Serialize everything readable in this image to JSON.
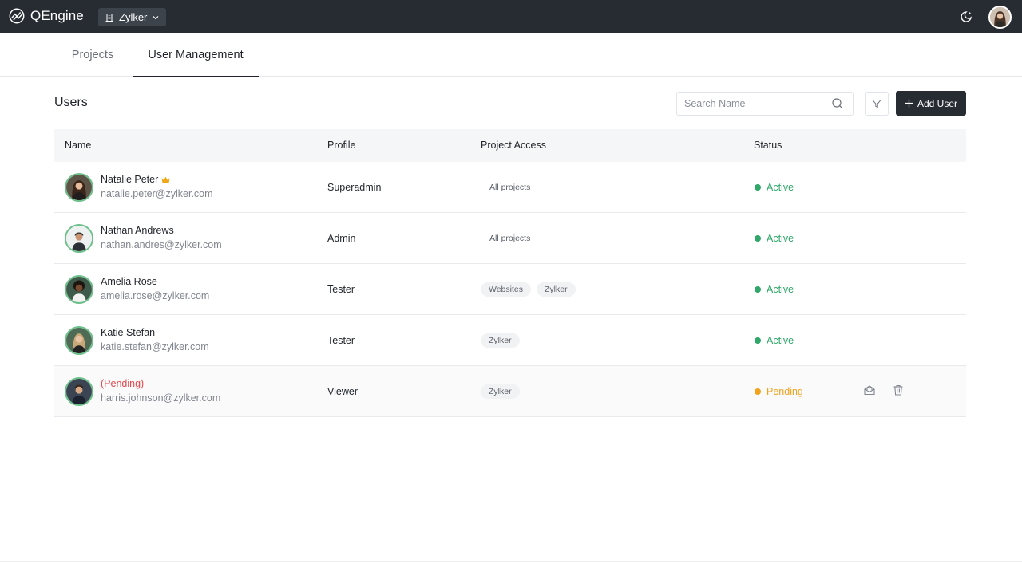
{
  "app": {
    "name": "QEngine",
    "org": "Zylker"
  },
  "tabs": [
    {
      "label": "Projects"
    },
    {
      "label": "User Management"
    }
  ],
  "section": {
    "title": "Users"
  },
  "search": {
    "placeholder": "Search Name",
    "value": ""
  },
  "toolbar": {
    "add_user_label": "Add User"
  },
  "table": {
    "headers": {
      "name": "Name",
      "profile": "Profile",
      "access": "Project Access",
      "status": "Status"
    },
    "rows": [
      {
        "name": "Natalie Peter",
        "email": "natalie.peter@zylker.com",
        "profile": "Superadmin",
        "access": [
          "All projects"
        ],
        "status": "Active"
      },
      {
        "name": "Nathan Andrews",
        "email": "nathan.andres@zylker.com",
        "profile": "Admin",
        "access": [
          "All projects"
        ],
        "status": "Active"
      },
      {
        "name": "Amelia Rose",
        "email": "amelia.rose@zylker.com",
        "profile": "Tester",
        "access": [
          "Websites",
          "Zylker"
        ],
        "status": "Active"
      },
      {
        "name": "Katie Stefan",
        "email": "katie.stefan@zylker.com",
        "profile": "Tester",
        "access": [
          "Zylker"
        ],
        "status": "Active"
      },
      {
        "name": "(Pending)",
        "email": "harris.johnson@zylker.com",
        "profile": "Viewer",
        "access": [
          "Zylker"
        ],
        "status": "Pending"
      }
    ]
  },
  "colors": {
    "topbar": "#272c33",
    "active": "#2fa86a",
    "pending": "#f2a21b",
    "pending_name": "#e5484d",
    "crown": "#f0a616"
  },
  "icons": [
    "qengine-logo-icon",
    "building-icon",
    "chevron-down-icon",
    "theme-toggle-icon",
    "search-icon",
    "filter-icon",
    "plus-icon",
    "crown-icon",
    "resend-invite-icon",
    "trash-icon"
  ]
}
